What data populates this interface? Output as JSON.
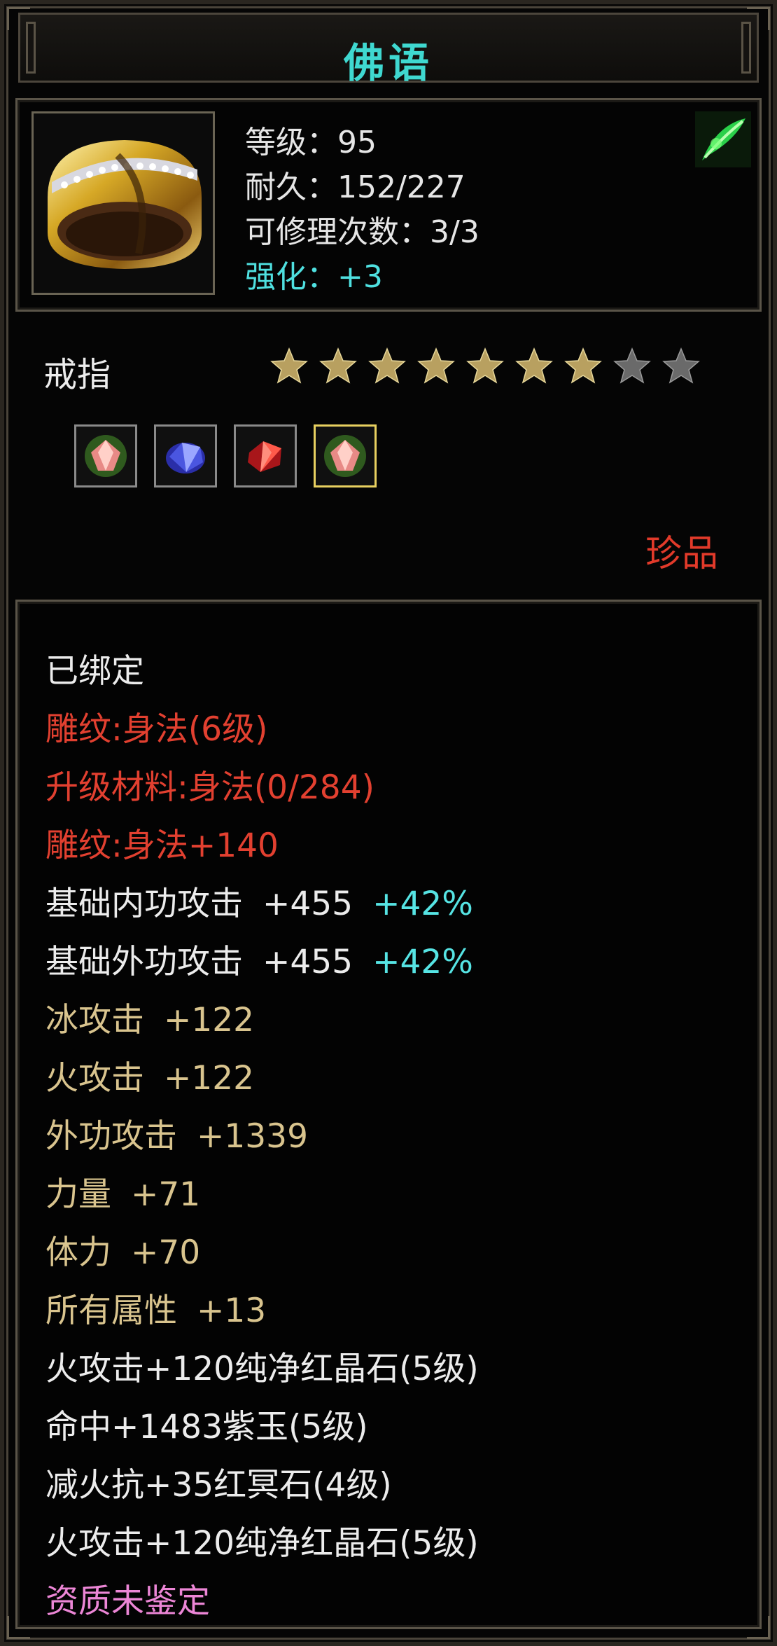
{
  "title": "佛语",
  "item": {
    "stats": [
      {
        "label": "等级：95",
        "color": "white"
      },
      {
        "label": "耐久：152/227",
        "color": "white"
      },
      {
        "label": "可修理次数：3/3",
        "color": "white"
      },
      {
        "label": "强化：+3",
        "color": "cyan"
      }
    ],
    "type": "戒指",
    "stars_total": 9,
    "stars_filled": 7,
    "gems": [
      "green-gem-icon",
      "blue-gem-icon",
      "red-gem-icon",
      "green-gem-icon"
    ],
    "rarity": "珍品"
  },
  "attributes": [
    {
      "text": "已绑定",
      "color": "white"
    },
    {
      "text": "雕纹:身法(6级)",
      "color": "red"
    },
    {
      "text": "升级材料:身法(0/284)",
      "color": "red"
    },
    {
      "text": "雕纹:身法+140",
      "color": "red"
    },
    {
      "label": "基础内功攻击",
      "value": "+455",
      "bonus": "+42%",
      "color": "white"
    },
    {
      "label": "基础外功攻击",
      "value": "+455",
      "bonus": "+42%",
      "color": "white"
    },
    {
      "label": "冰攻击",
      "value": "+122",
      "color": "tan"
    },
    {
      "label": "火攻击",
      "value": "+122",
      "color": "tan"
    },
    {
      "label": "外功攻击",
      "value": "+1339",
      "color": "tan"
    },
    {
      "label": "力量",
      "value": "+71",
      "color": "tan"
    },
    {
      "label": "体力",
      "value": "+70",
      "color": "tan"
    },
    {
      "label": "所有属性",
      "value": "+13",
      "color": "tan"
    },
    {
      "text": "火攻击+120纯净红晶石(5级)",
      "color": "white"
    },
    {
      "text": "命中+1483紫玉(5级)",
      "color": "white"
    },
    {
      "text": "减火抗+35红冥石(4级)",
      "color": "white"
    },
    {
      "text": "火攻击+120纯净红晶石(5级)",
      "color": "white"
    },
    {
      "text": "资质未鉴定",
      "color": "pink"
    }
  ],
  "colors": {
    "title": "#3fd8d0",
    "red": "#e24030",
    "tan": "#d9c48e",
    "cyan": "#56e4e4",
    "pink": "#ec86d6",
    "star_gold": "#b8a060",
    "star_grey": "#6a6a6a"
  }
}
